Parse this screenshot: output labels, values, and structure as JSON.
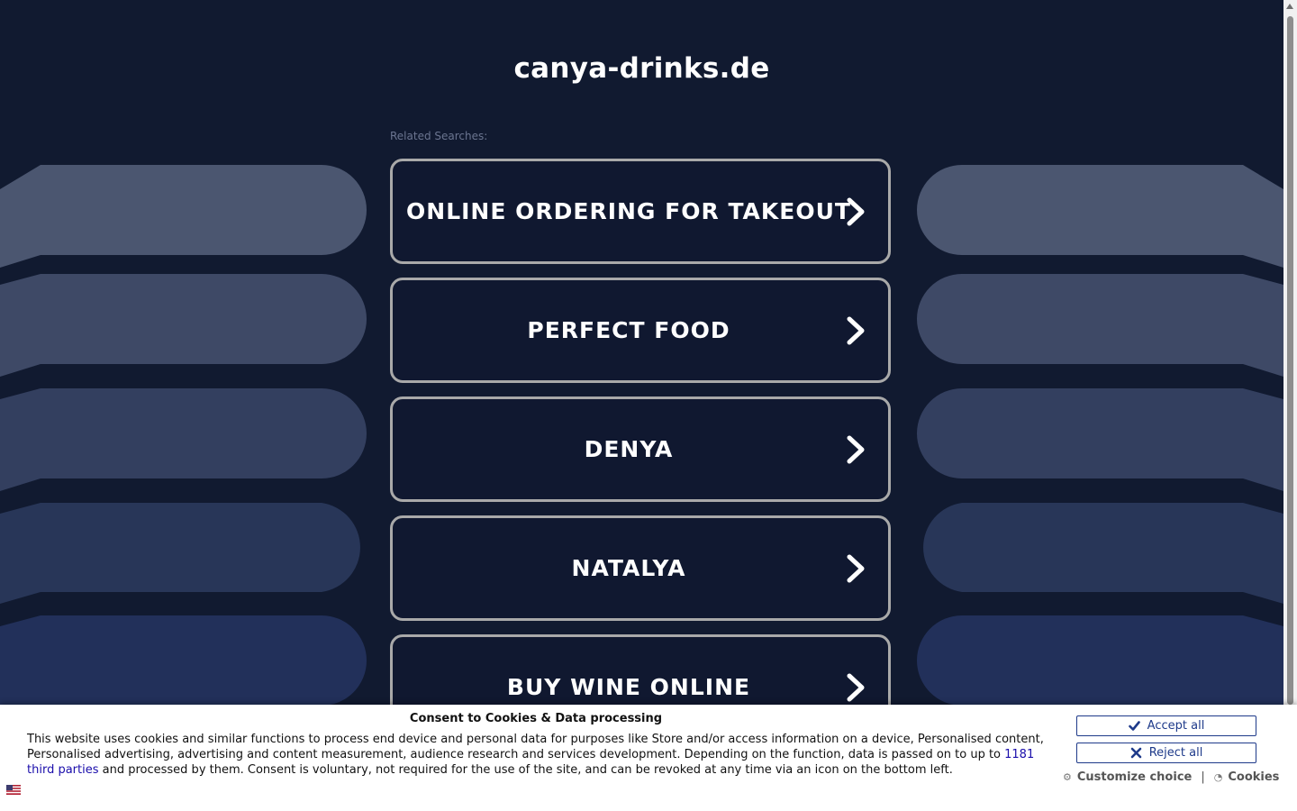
{
  "site": {
    "title": "canya-drinks.de"
  },
  "related": {
    "label": "Related Searches:",
    "links": [
      {
        "label": "ONLINE ORDERING FOR TAKEOUT"
      },
      {
        "label": "PERFECT FOOD"
      },
      {
        "label": "DENYA"
      },
      {
        "label": "NATALYA"
      },
      {
        "label": "BUY WINE ONLINE"
      }
    ]
  },
  "consent": {
    "title": "Consent to Cookies & Data processing",
    "text_part1": "This website uses cookies and similar functions to process end device and personal data for purposes like Store and/or access information on a device, Personalised content, Personalised advertising, advertising and content measurement, audience research and services development. Depending on the function, data is passed on to up to ",
    "third_parties_link": "1181 third parties",
    "text_part2": " and processed by them. Consent is voluntary, not required for the use of the site, and can be revoked at any time via an icon on the bottom left.",
    "accept_label": "Accept all",
    "reject_label": "Reject all",
    "customize_label": "Customize choice",
    "separator": "|",
    "cookies_label": "Cookies"
  },
  "colors": {
    "background": "#111a30",
    "link_border": "#a9a9a9",
    "button_accent": "#1e3a8a"
  }
}
